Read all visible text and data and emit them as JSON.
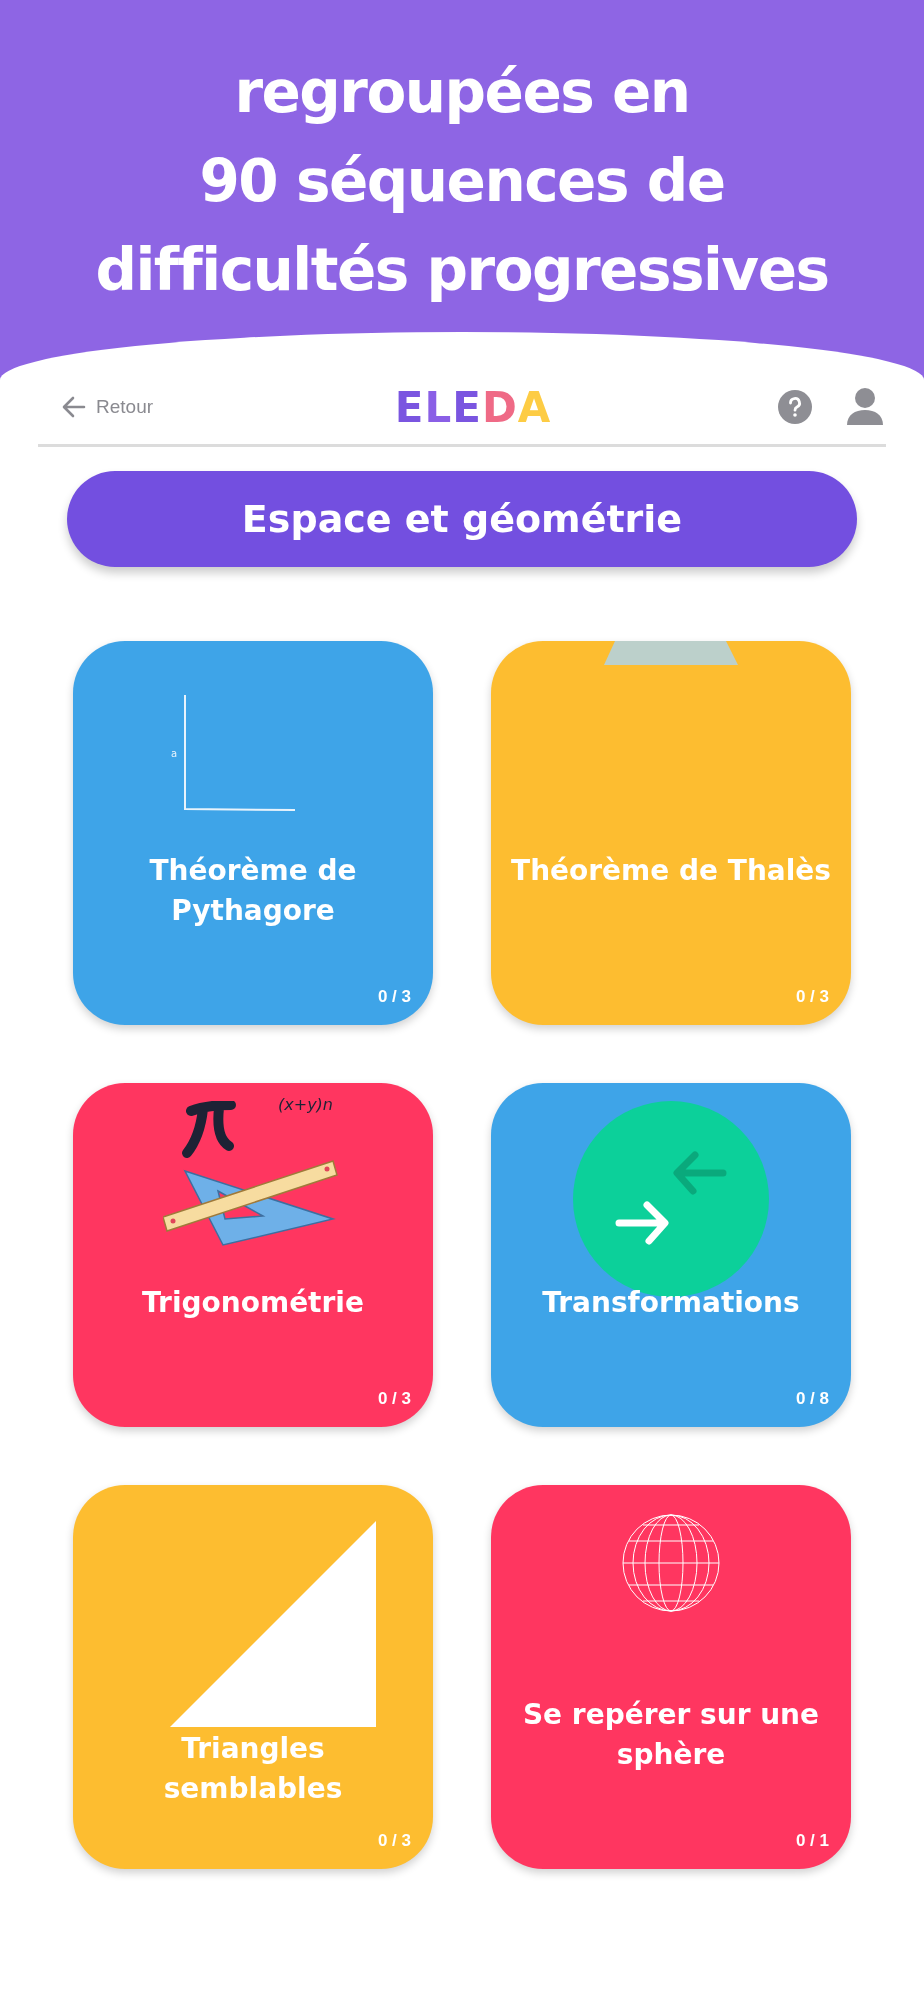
{
  "banner": {
    "lines": [
      "regroupées en",
      "90 séquences de",
      "difficultés progressives"
    ]
  },
  "nav": {
    "back_label": "Retour",
    "logo": "ELEDA"
  },
  "section_button": {
    "label": "Espace et géométrie"
  },
  "cards": [
    {
      "kind": "pythagore",
      "title": "Théorème de Pythagore",
      "progress": "0 / 3",
      "color": "#3ea4e8",
      "diagram_label": "a"
    },
    {
      "kind": "thales",
      "title": "Théorème de Thalès",
      "progress": "0 / 3",
      "color": "#fdbd30"
    },
    {
      "kind": "trig",
      "title": "Trigonométrie",
      "progress": "0 / 3",
      "color": "#ff3660",
      "formula": "(x+y)n"
    },
    {
      "kind": "transform",
      "title": "Transformations",
      "progress": "0 / 8",
      "color": "#3ea4e8"
    },
    {
      "kind": "triangle",
      "title": "Triangles semblables",
      "progress": "0 / 3",
      "color": "#fdbd30"
    },
    {
      "kind": "sphere",
      "title": "Se repérer sur une sphère",
      "progress": "0 / 1",
      "color": "#ff3660"
    }
  ]
}
